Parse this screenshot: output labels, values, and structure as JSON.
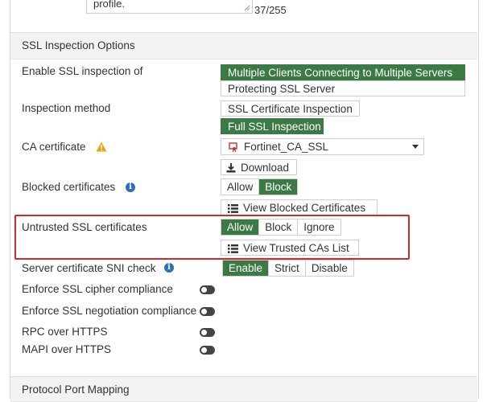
{
  "top": {
    "textarea_tail": "profile.",
    "counter": "37/255"
  },
  "ssl_section": {
    "title": "SSL Inspection Options",
    "enable_label": "Enable SSL inspection of",
    "enable_options": [
      "Multiple Clients Connecting to Multiple Servers",
      "Protecting SSL Server"
    ],
    "enable_selected": "Multiple Clients Connecting to Multiple Servers",
    "method_label": "Inspection method",
    "method_options": [
      "SSL Certificate Inspection",
      "Full SSL Inspection"
    ],
    "method_selected": "Full SSL Inspection",
    "ca_label": "CA certificate",
    "ca_value": "Fortinet_CA_SSL",
    "download_label": "Download",
    "blocked_label": "Blocked certificates",
    "blocked_options": [
      "Allow",
      "Block"
    ],
    "blocked_selected": "Block",
    "view_blocked_label": "View Blocked Certificates",
    "untrusted_label": "Untrusted SSL certificates",
    "untrusted_options": [
      "Allow",
      "Block",
      "Ignore"
    ],
    "untrusted_selected": "Allow",
    "view_trusted_label": "View Trusted CAs List",
    "sni_label": "Server certificate SNI check",
    "sni_options": [
      "Enable",
      "Strict",
      "Disable"
    ],
    "sni_selected": "Enable",
    "cipher_label": "Enforce SSL cipher compliance",
    "cipher_on": false,
    "negotiation_label": "Enforce SSL negotiation compliance",
    "negotiation_on": false,
    "rpc_label": "RPC over HTTPS",
    "rpc_on": false,
    "mapi_label": "MAPI over HTTPS",
    "mapi_on": false
  },
  "port_section": {
    "title": "Protocol Port Mapping"
  },
  "colors": {
    "accent": "#3c7a45",
    "highlight_border": "#d9262b",
    "info": "#2e6fba",
    "warning": "#e8a317"
  }
}
